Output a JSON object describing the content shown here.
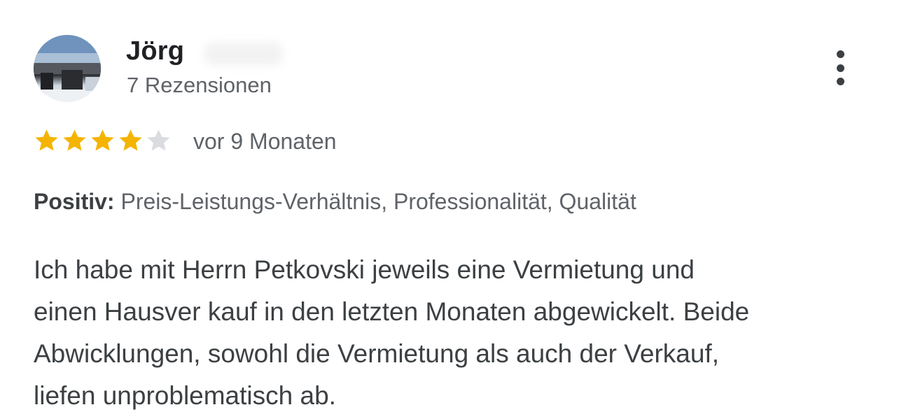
{
  "reviewer": {
    "name": "Jörg",
    "review_count": "7 Rezensionen"
  },
  "rating": {
    "stars": 4,
    "max": 5,
    "date": "vor 9 Monaten"
  },
  "positive": {
    "label": "Positiv:",
    "items": "Preis-Leistungs-Verhältnis, Professionalität, Qualität"
  },
  "review_text": {
    "lines": [
      "Ich habe mit Herrn Petkovski jeweils eine Vermietung und",
      "einen Hausver kauf in den letzten Monaten abgewickelt. Beide",
      "Abwicklungen, sowohl die Vermietung als auch der Verkauf,",
      "liefen unproblematisch ab."
    ]
  },
  "icons": {
    "more": "more-vert-icon",
    "star_filled": "star-filled-icon",
    "star_empty": "star-empty-icon"
  },
  "colors": {
    "star_filled": "#f4b400",
    "star_empty": "#dadce0",
    "name": "#202124",
    "secondary_text": "#5f6368",
    "body_text": "#3c4043"
  }
}
